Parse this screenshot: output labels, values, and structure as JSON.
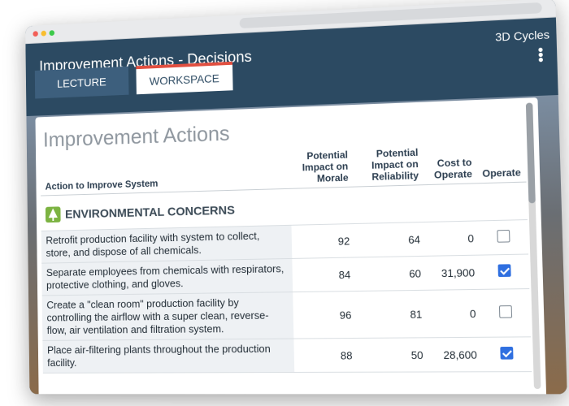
{
  "app": {
    "title": "Improvement Actions - Decisions",
    "brand": "3D Cycles"
  },
  "tabs": [
    {
      "label": "LECTURE"
    },
    {
      "label": "WORKSPACE"
    }
  ],
  "panel": {
    "title": "Improvement Actions"
  },
  "table": {
    "headers": [
      "Action to Improve System",
      "Potential Impact on Morale",
      "Potential Impact on Reliability",
      "Cost to Operate",
      "Operate"
    ],
    "category": "ENVIRONMENTAL CONCERNS",
    "rows": [
      {
        "action": "Retrofit production facility with system to collect, store, and dispose of all chemicals.",
        "morale": "92",
        "reliability": "64",
        "cost": "0",
        "operate": false
      },
      {
        "action": "Separate employees from chemicals with respirators, protective clothing, and gloves.",
        "morale": "84",
        "reliability": "60",
        "cost": "31,900",
        "operate": true
      },
      {
        "action": "Create a \"clean room\" production facility by controlling the airflow with a super clean, reverse-flow, air ventilation and filtration system.",
        "morale": "96",
        "reliability": "81",
        "cost": "0",
        "operate": false
      },
      {
        "action": "Place air-filtering plants throughout the production facility.",
        "morale": "88",
        "reliability": "50",
        "cost": "28,600",
        "operate": true
      }
    ]
  }
}
